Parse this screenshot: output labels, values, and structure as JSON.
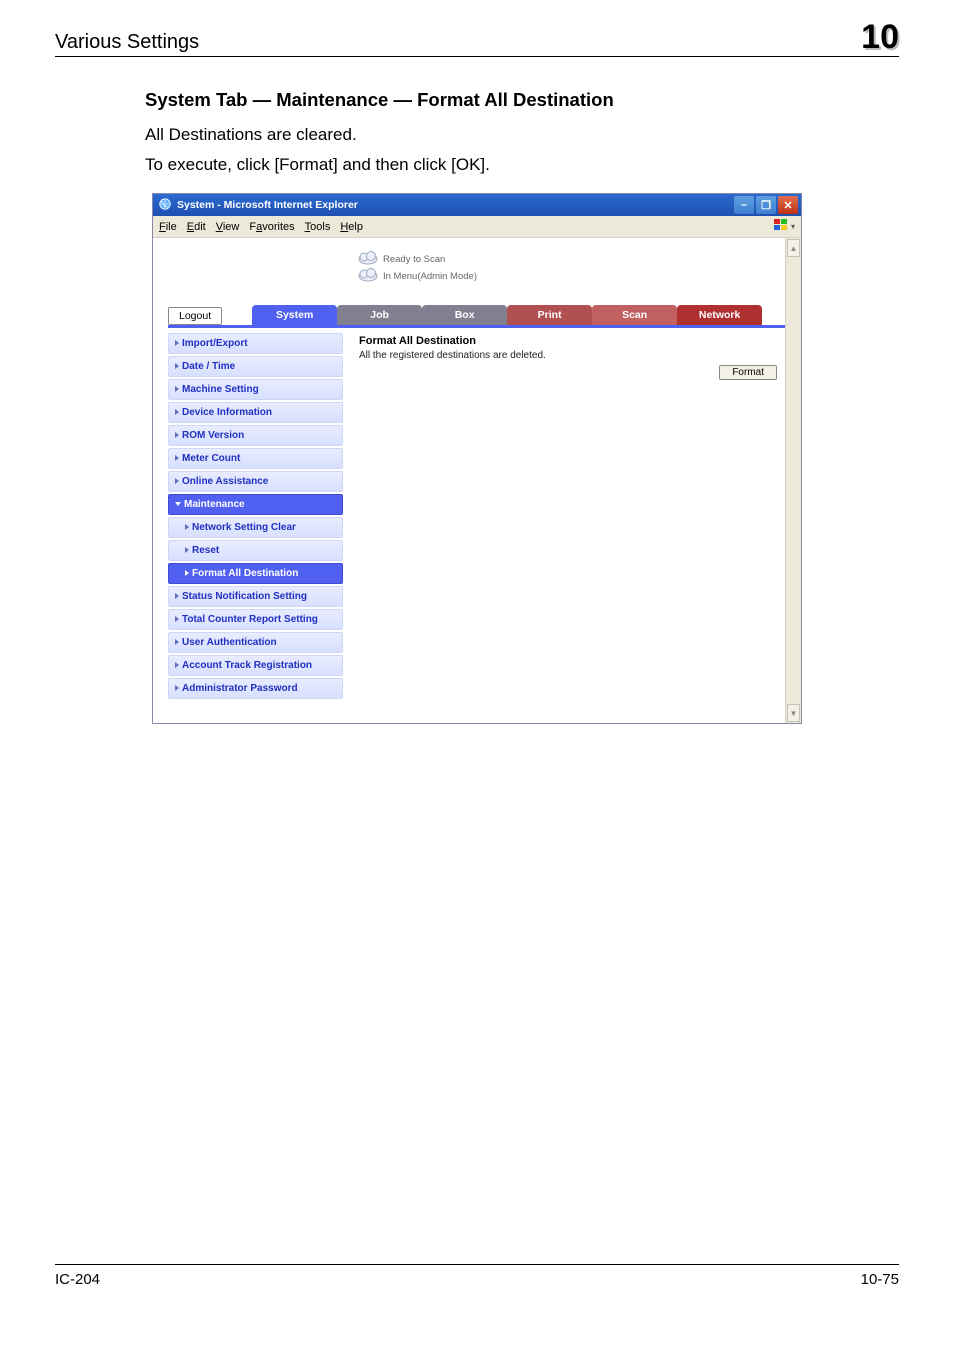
{
  "header": {
    "left": "Various Settings",
    "right": "10"
  },
  "body": {
    "title": "System Tab — Maintenance — Format All Destination",
    "line1": "All Destinations are cleared.",
    "line2": "To execute, click [Format] and then click [OK]."
  },
  "ie": {
    "title": "System - Microsoft Internet Explorer",
    "menus": {
      "file": "File",
      "edit": "Edit",
      "view": "View",
      "favorites": "Favorites",
      "tools": "Tools",
      "help": "Help"
    },
    "status": {
      "ready": "Ready to Scan",
      "menu": "In Menu(Admin Mode)"
    },
    "logout": "Logout",
    "tabs": {
      "system": "System",
      "job": "Job",
      "box": "Box",
      "print": "Print",
      "scan": "Scan",
      "network": "Network"
    },
    "sidebar": [
      {
        "label": "Import/Export"
      },
      {
        "label": "Date / Time"
      },
      {
        "label": "Machine Setting"
      },
      {
        "label": "Device Information"
      },
      {
        "label": "ROM Version"
      },
      {
        "label": "Meter Count"
      },
      {
        "label": "Online Assistance"
      },
      {
        "label": "Maintenance",
        "selected": true,
        "expandable": true
      },
      {
        "label": "Network Setting Clear",
        "sub": true
      },
      {
        "label": "Reset",
        "sub": true
      },
      {
        "label": "Format All Destination",
        "sub": true,
        "selected": true
      },
      {
        "label": "Status Notification Setting"
      },
      {
        "label": "Total Counter Report Setting"
      },
      {
        "label": "User Authentication"
      },
      {
        "label": "Account Track Registration"
      },
      {
        "label": "Administrator Password"
      }
    ],
    "main": {
      "heading": "Format All Destination",
      "desc": "All the registered destinations are deleted.",
      "button": "Format"
    }
  },
  "footer": {
    "left": "IC-204",
    "right": "10-75"
  }
}
